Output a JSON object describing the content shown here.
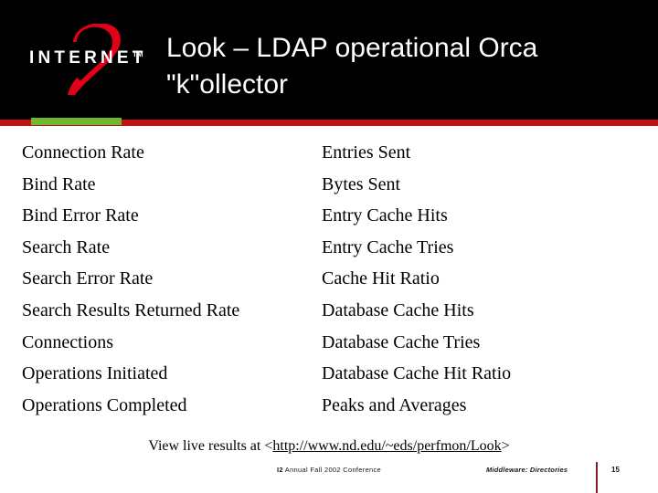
{
  "slide": {
    "title": "Look – LDAP operational Orca \"k\"ollector",
    "background_color": "#ffffff",
    "header_color": "#000000"
  },
  "logo": {
    "wordmark": "INTERNET",
    "trademark": "TM",
    "numeral": "2",
    "numeral_color": "#e00018",
    "wordmark_color": "#ffffff"
  },
  "divider": {
    "green_color": "#6cbb2c",
    "red_color": "#bf1212"
  },
  "metrics": {
    "left_column": [
      "Connection Rate",
      "Bind Rate",
      "Bind Error Rate",
      "Search Rate",
      "Search Error Rate",
      "Search Results Returned Rate",
      "Connections",
      "Operations Initiated",
      "Operations Completed"
    ],
    "right_column": [
      "Entries Sent",
      "Bytes Sent",
      "Entry Cache Hits",
      "Entry Cache Tries",
      "Cache Hit Ratio",
      "Database Cache Hits",
      "Database Cache Tries",
      "Database Cache Hit Ratio",
      "Peaks and Averages"
    ]
  },
  "footer_link": {
    "prefix": "View live results at <",
    "url": "http://www.nd.edu/~eds/perfmon/Look",
    "suffix": ">"
  },
  "status": {
    "conference_mark": "I2",
    "conference": " Annual Fall 2002 Conference",
    "track": "Middleware: Directories",
    "page_number": "15",
    "rule_color": "#8a1f1f"
  }
}
